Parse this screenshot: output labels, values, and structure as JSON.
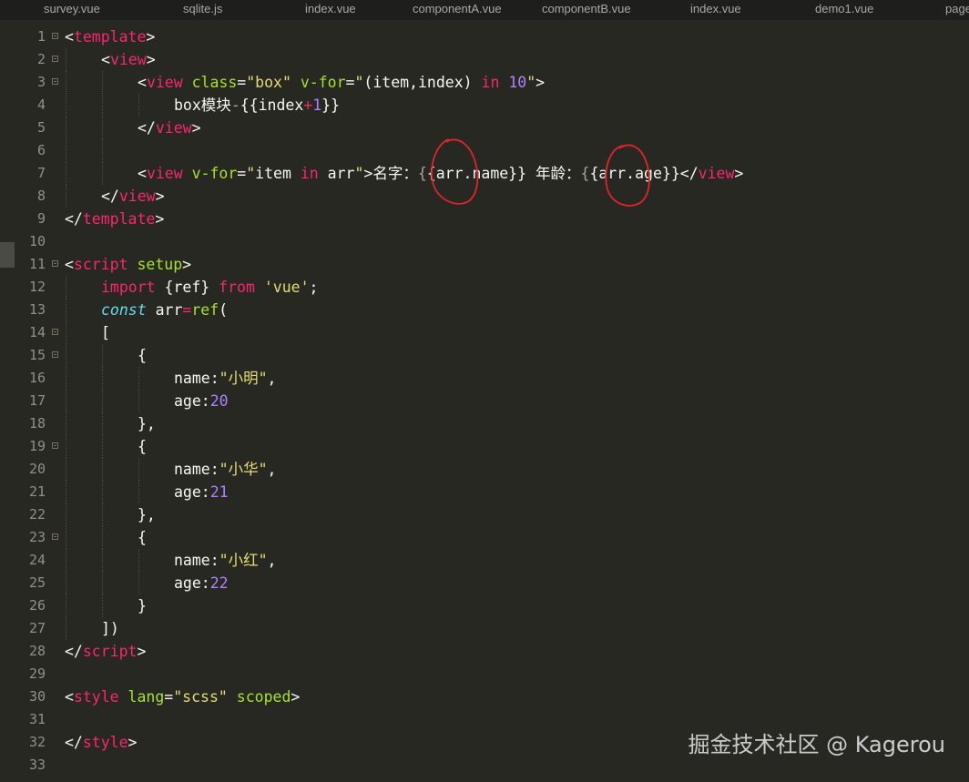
{
  "tabs": [
    "survey.vue",
    "sqlite.js",
    "index.vue",
    "componentA.vue",
    "componentB.vue",
    "index.vue",
    "demo1.vue",
    "page"
  ],
  "colors": {
    "background": "#272822",
    "tag": "#f92672",
    "attribute": "#a6e22e",
    "string": "#e6db74",
    "number": "#ae81ff",
    "keyword": "#f92672",
    "italic_keyword": "#66d9ef",
    "plain": "#f8f8f2",
    "line_number": "#8f908a",
    "annotation_circle": "#e0242a"
  },
  "editor": {
    "lines": [
      {
        "n": "1",
        "fold": true,
        "indent": 0,
        "tokens": [
          [
            "p",
            "<"
          ],
          [
            "tag",
            "template"
          ],
          [
            "p",
            ">"
          ]
        ]
      },
      {
        "n": "2",
        "fold": true,
        "indent": 1,
        "tokens": [
          [
            "p",
            "<"
          ],
          [
            "tag",
            "view"
          ],
          [
            "p",
            ">"
          ]
        ]
      },
      {
        "n": "3",
        "fold": true,
        "indent": 2,
        "tokens": [
          [
            "p",
            "<"
          ],
          [
            "tag",
            "view"
          ],
          [
            "p",
            " "
          ],
          [
            "attr",
            "class"
          ],
          [
            "p",
            "="
          ],
          [
            "str",
            "\"box\""
          ],
          [
            "p",
            " "
          ],
          [
            "attr",
            "v-for"
          ],
          [
            "p",
            "="
          ],
          [
            "str",
            "\""
          ],
          [
            "p",
            "(item,index) "
          ],
          [
            "kw",
            "in"
          ],
          [
            "p",
            " "
          ],
          [
            "num",
            "10"
          ],
          [
            "str",
            "\""
          ],
          [
            "p",
            ">"
          ]
        ]
      },
      {
        "n": "4",
        "fold": false,
        "indent": 3,
        "tokens": [
          [
            "p",
            "box模块"
          ],
          [
            "mu",
            "-"
          ],
          [
            "p",
            "{{index"
          ],
          [
            "kw",
            "+"
          ],
          [
            "num",
            "1"
          ],
          [
            "p",
            "}}"
          ]
        ]
      },
      {
        "n": "5",
        "fold": false,
        "indent": 2,
        "tokens": [
          [
            "p",
            "</"
          ],
          [
            "tag",
            "view"
          ],
          [
            "p",
            ">"
          ]
        ]
      },
      {
        "n": "6",
        "fold": false,
        "indent": 2,
        "tokens": []
      },
      {
        "n": "7",
        "fold": false,
        "indent": 2,
        "tokens": [
          [
            "p",
            "<"
          ],
          [
            "tag",
            "view"
          ],
          [
            "p",
            " "
          ],
          [
            "attr",
            "v-for"
          ],
          [
            "p",
            "="
          ],
          [
            "str",
            "\""
          ],
          [
            "p",
            "item "
          ],
          [
            "kw",
            "in"
          ],
          [
            "p",
            " arr"
          ],
          [
            "str",
            "\""
          ],
          [
            "p",
            ">名字："
          ],
          [
            "mu",
            "{"
          ],
          [
            "p",
            "{arr.name}} 年龄："
          ],
          [
            "mu",
            "{"
          ],
          [
            "p",
            "{arr.age}}</"
          ],
          [
            "tag",
            "view"
          ],
          [
            "p",
            ">"
          ]
        ]
      },
      {
        "n": "8",
        "fold": false,
        "indent": 1,
        "tokens": [
          [
            "p",
            "</"
          ],
          [
            "tag",
            "view"
          ],
          [
            "p",
            ">"
          ]
        ]
      },
      {
        "n": "9",
        "fold": false,
        "indent": 0,
        "tokens": [
          [
            "p",
            "</"
          ],
          [
            "tag",
            "template"
          ],
          [
            "p",
            ">"
          ]
        ]
      },
      {
        "n": "10",
        "fold": false,
        "indent": 0,
        "tokens": []
      },
      {
        "n": "11",
        "fold": true,
        "indent": 0,
        "tokens": [
          [
            "p",
            "<"
          ],
          [
            "tag",
            "script"
          ],
          [
            "p",
            " "
          ],
          [
            "attr",
            "setup"
          ],
          [
            "p",
            ">"
          ]
        ]
      },
      {
        "n": "12",
        "fold": false,
        "indent": 1,
        "tokens": [
          [
            "kw",
            "import"
          ],
          [
            "p",
            " {ref} "
          ],
          [
            "kw",
            "from"
          ],
          [
            "p",
            " "
          ],
          [
            "str",
            "'vue'"
          ],
          [
            "p",
            ";"
          ]
        ]
      },
      {
        "n": "13",
        "fold": false,
        "indent": 1,
        "tokens": [
          [
            "it",
            "const"
          ],
          [
            "p",
            " arr"
          ],
          [
            "kw",
            "="
          ],
          [
            "fn",
            "ref"
          ],
          [
            "p",
            "("
          ]
        ]
      },
      {
        "n": "14",
        "fold": true,
        "indent": 1,
        "tokens": [
          [
            "p",
            "["
          ]
        ]
      },
      {
        "n": "15",
        "fold": true,
        "indent": 2,
        "tokens": [
          [
            "p",
            "{"
          ]
        ]
      },
      {
        "n": "16",
        "fold": false,
        "indent": 3,
        "tokens": [
          [
            "p",
            "name:"
          ],
          [
            "str",
            "\"小明\""
          ],
          [
            "p",
            ","
          ]
        ]
      },
      {
        "n": "17",
        "fold": false,
        "indent": 3,
        "tokens": [
          [
            "p",
            "age:"
          ],
          [
            "num",
            "20"
          ]
        ]
      },
      {
        "n": "18",
        "fold": false,
        "indent": 2,
        "tokens": [
          [
            "p",
            "},"
          ]
        ]
      },
      {
        "n": "19",
        "fold": true,
        "indent": 2,
        "tokens": [
          [
            "p",
            "{"
          ]
        ]
      },
      {
        "n": "20",
        "fold": false,
        "indent": 3,
        "tokens": [
          [
            "p",
            "name:"
          ],
          [
            "str",
            "\"小华\""
          ],
          [
            "p",
            ","
          ]
        ]
      },
      {
        "n": "21",
        "fold": false,
        "indent": 3,
        "tokens": [
          [
            "p",
            "age:"
          ],
          [
            "num",
            "21"
          ]
        ]
      },
      {
        "n": "22",
        "fold": false,
        "indent": 2,
        "tokens": [
          [
            "p",
            "},"
          ]
        ]
      },
      {
        "n": "23",
        "fold": true,
        "indent": 2,
        "tokens": [
          [
            "p",
            "{"
          ]
        ]
      },
      {
        "n": "24",
        "fold": false,
        "indent": 3,
        "tokens": [
          [
            "p",
            "name:"
          ],
          [
            "str",
            "\"小红\""
          ],
          [
            "p",
            ","
          ]
        ]
      },
      {
        "n": "25",
        "fold": false,
        "indent": 3,
        "tokens": [
          [
            "p",
            "age:"
          ],
          [
            "num",
            "22"
          ]
        ]
      },
      {
        "n": "26",
        "fold": false,
        "indent": 2,
        "tokens": [
          [
            "p",
            "}"
          ]
        ]
      },
      {
        "n": "27",
        "fold": false,
        "indent": 1,
        "tokens": [
          [
            "p",
            "])"
          ]
        ]
      },
      {
        "n": "28",
        "fold": false,
        "indent": 0,
        "tokens": [
          [
            "p",
            "</"
          ],
          [
            "tag",
            "script"
          ],
          [
            "p",
            ">"
          ]
        ]
      },
      {
        "n": "29",
        "fold": false,
        "indent": 0,
        "tokens": []
      },
      {
        "n": "30",
        "fold": false,
        "indent": 0,
        "tokens": [
          [
            "p",
            "<"
          ],
          [
            "tag",
            "style"
          ],
          [
            "p",
            " "
          ],
          [
            "attr",
            "lang"
          ],
          [
            "p",
            "="
          ],
          [
            "str",
            "\"scss\""
          ],
          [
            "p",
            " "
          ],
          [
            "attr",
            "scoped"
          ],
          [
            "p",
            ">"
          ]
        ]
      },
      {
        "n": "31",
        "fold": false,
        "indent": 0,
        "tokens": []
      },
      {
        "n": "32",
        "fold": false,
        "indent": 0,
        "tokens": [
          [
            "p",
            "</"
          ],
          [
            "tag",
            "style"
          ],
          [
            "p",
            ">"
          ]
        ]
      },
      {
        "n": "33",
        "fold": false,
        "indent": 0,
        "tokens": []
      }
    ]
  },
  "annotations": [
    {
      "shape": "circle",
      "marks": "arr in {{arr.name}}"
    },
    {
      "shape": "circle",
      "marks": "arr in {{arr.age}}"
    }
  ],
  "watermark": "掘金技术社区 @ Kagerou"
}
